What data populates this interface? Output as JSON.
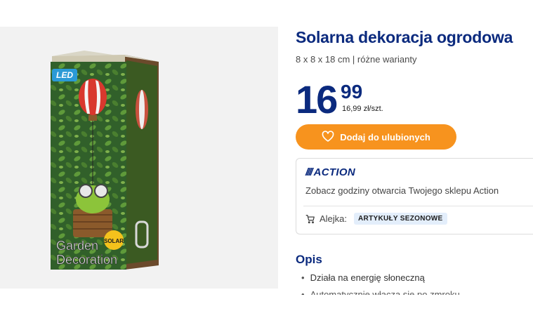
{
  "product": {
    "title": "Solarna dekoracja ogrodowa",
    "subtitle": "8 x 8 x 18 cm | różne warianty",
    "image": {
      "icon": "garden-decoration-box-image",
      "led_badge": "LED",
      "box_text_line1": "Garden",
      "box_text_line2": "Decoration",
      "solar_badge": "SOLAR"
    }
  },
  "price": {
    "integer": "16",
    "decimal": "99",
    "unit_price": "16,99 zł/szt.",
    "color": "#0b2a7e"
  },
  "favorites_button": {
    "label": "Dodaj do ulubionych",
    "icon": "heart-icon",
    "color": "#f7931e"
  },
  "store": {
    "logo_text": "ACTION",
    "link_text": "Zobacz godziny otwarcia Twojego sklepu Action",
    "aisle_label": "Alejka:",
    "aisle_icon": "cart-icon",
    "aisle_value": "ARTYKUŁY SEZONOWE"
  },
  "description": {
    "heading": "Opis",
    "items": [
      "Działa na energię słoneczną",
      "Automatycznie włącza się po zmroku"
    ]
  }
}
